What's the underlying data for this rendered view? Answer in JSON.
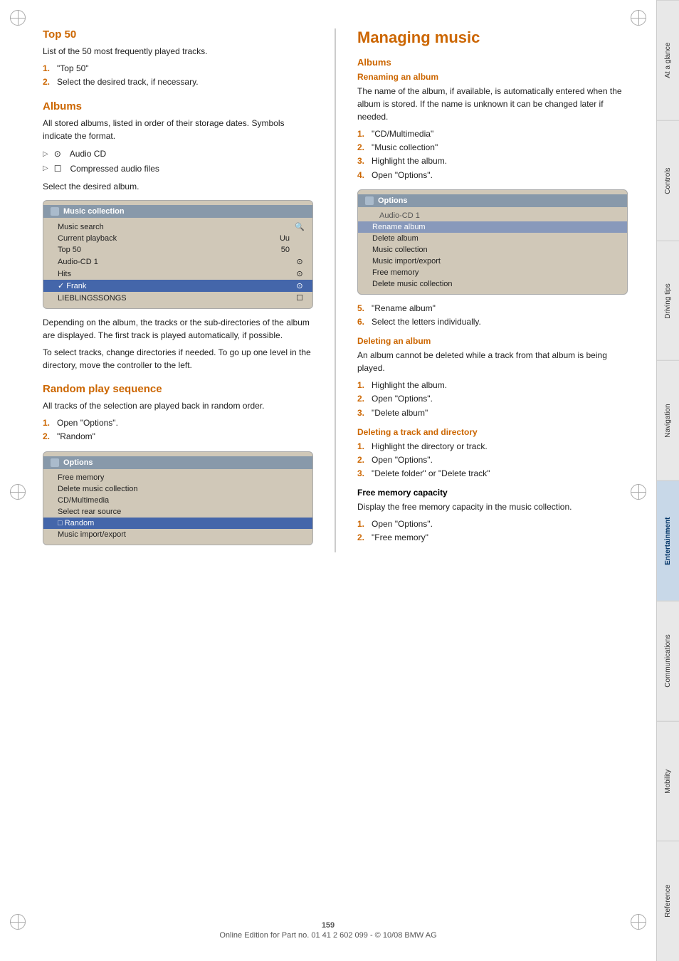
{
  "tabs": [
    {
      "label": "At a glance",
      "active": false
    },
    {
      "label": "Controls",
      "active": false
    },
    {
      "label": "Driving tips",
      "active": false
    },
    {
      "label": "Navigation",
      "active": false
    },
    {
      "label": "Entertainment",
      "active": true
    },
    {
      "label": "Communications",
      "active": false
    },
    {
      "label": "Mobility",
      "active": false
    },
    {
      "label": "Reference",
      "active": false
    }
  ],
  "left": {
    "top50_heading": "Top 50",
    "top50_desc": "List of the 50 most frequently played tracks.",
    "top50_steps": [
      {
        "num": "1.",
        "text": "\"Top 50\""
      },
      {
        "num": "2.",
        "text": "Select the desired track, if necessary."
      }
    ],
    "albums_heading": "Albums",
    "albums_desc": "All stored albums, listed in order of their storage dates. Symbols indicate the format.",
    "albums_bullets": [
      {
        "icon": "⊙",
        "text": "Audio CD"
      },
      {
        "icon": "☐",
        "text": "Compressed audio files"
      }
    ],
    "albums_select": "Select the desired album.",
    "screenshot1": {
      "title": "Music collection",
      "rows": [
        {
          "label": "Music search",
          "value": "",
          "icon": "🔍",
          "state": "normal"
        },
        {
          "label": "Current playback",
          "value": "Uu",
          "icon": "",
          "state": "normal"
        },
        {
          "label": "Top 50",
          "value": "50",
          "icon": "",
          "state": "normal"
        },
        {
          "label": "Audio-CD 1",
          "value": "",
          "icon": "⊙",
          "state": "normal"
        },
        {
          "label": "Hits",
          "value": "",
          "icon": "⊙",
          "state": "normal"
        },
        {
          "label": "✓ Frank",
          "value": "",
          "icon": "⊙",
          "state": "selected"
        },
        {
          "label": "LIEBLINGSSONGS",
          "value": "",
          "icon": "☐",
          "state": "normal"
        }
      ]
    },
    "album_desc2": "Depending on the album, the tracks or the sub-directories of the album are displayed. The first track is played automatically, if possible.",
    "album_desc3": "To select tracks, change directories if needed. To go up one level in the directory, move the controller to the left.",
    "random_heading": "Random play sequence",
    "random_desc": "All tracks of the selection are played back in random order.",
    "random_steps": [
      {
        "num": "1.",
        "text": "Open \"Options\"."
      },
      {
        "num": "2.",
        "text": "\"Random\""
      }
    ],
    "screenshot2": {
      "title": "Options",
      "rows": [
        {
          "label": "Free memory",
          "state": "normal"
        },
        {
          "label": "Delete music collection",
          "state": "normal"
        },
        {
          "label": "CD/Multimedia",
          "state": "normal"
        },
        {
          "label": "Select rear source",
          "state": "normal"
        },
        {
          "label": "□ Random",
          "state": "selected"
        },
        {
          "label": "Music import/export",
          "state": "normal"
        }
      ]
    }
  },
  "right": {
    "page_heading": "Managing music",
    "albums_heading": "Albums",
    "rename_heading": "Renaming an album",
    "rename_desc": "The name of the album, if available, is automatically entered when the album is stored. If the name is unknown it can be changed later if needed.",
    "rename_steps": [
      {
        "num": "1.",
        "text": "\"CD/Multimedia\""
      },
      {
        "num": "2.",
        "text": "\"Music collection\""
      },
      {
        "num": "3.",
        "text": "Highlight the album."
      },
      {
        "num": "4.",
        "text": "Open \"Options\"."
      }
    ],
    "screenshot3": {
      "title": "Options",
      "above": "Audio-CD 1",
      "rows": [
        {
          "label": "Rename album",
          "state": "highlighted"
        },
        {
          "label": "Delete album",
          "state": "normal"
        },
        {
          "label": "Music collection",
          "state": "normal"
        },
        {
          "label": "Music import/export",
          "state": "normal"
        },
        {
          "label": "Free memory",
          "state": "normal"
        },
        {
          "label": "Delete music collection",
          "state": "normal"
        }
      ]
    },
    "rename_steps2": [
      {
        "num": "5.",
        "text": "\"Rename album\""
      },
      {
        "num": "6.",
        "text": "Select the letters individually."
      }
    ],
    "delete_album_heading": "Deleting an album",
    "delete_album_desc": "An album cannot be deleted while a track from that album is being played.",
    "delete_album_steps": [
      {
        "num": "1.",
        "text": "Highlight the album."
      },
      {
        "num": "2.",
        "text": "Open \"Options\"."
      },
      {
        "num": "3.",
        "text": "\"Delete album\""
      }
    ],
    "delete_track_heading": "Deleting a track and directory",
    "delete_track_steps": [
      {
        "num": "1.",
        "text": "Highlight the directory or track."
      },
      {
        "num": "2.",
        "text": "Open \"Options\"."
      },
      {
        "num": "3.",
        "text": "\"Delete folder\" or \"Delete track\""
      }
    ],
    "free_memory_heading": "Free memory capacity",
    "free_memory_desc": "Display the free memory capacity in the music collection.",
    "free_memory_steps": [
      {
        "num": "1.",
        "text": "Open \"Options\"."
      },
      {
        "num": "2.",
        "text": "\"Free memory\""
      }
    ]
  },
  "footer": {
    "page_number": "159",
    "edition": "Online Edition for Part no. 01 41 2 602 099 - © 10/08 BMW AG"
  }
}
